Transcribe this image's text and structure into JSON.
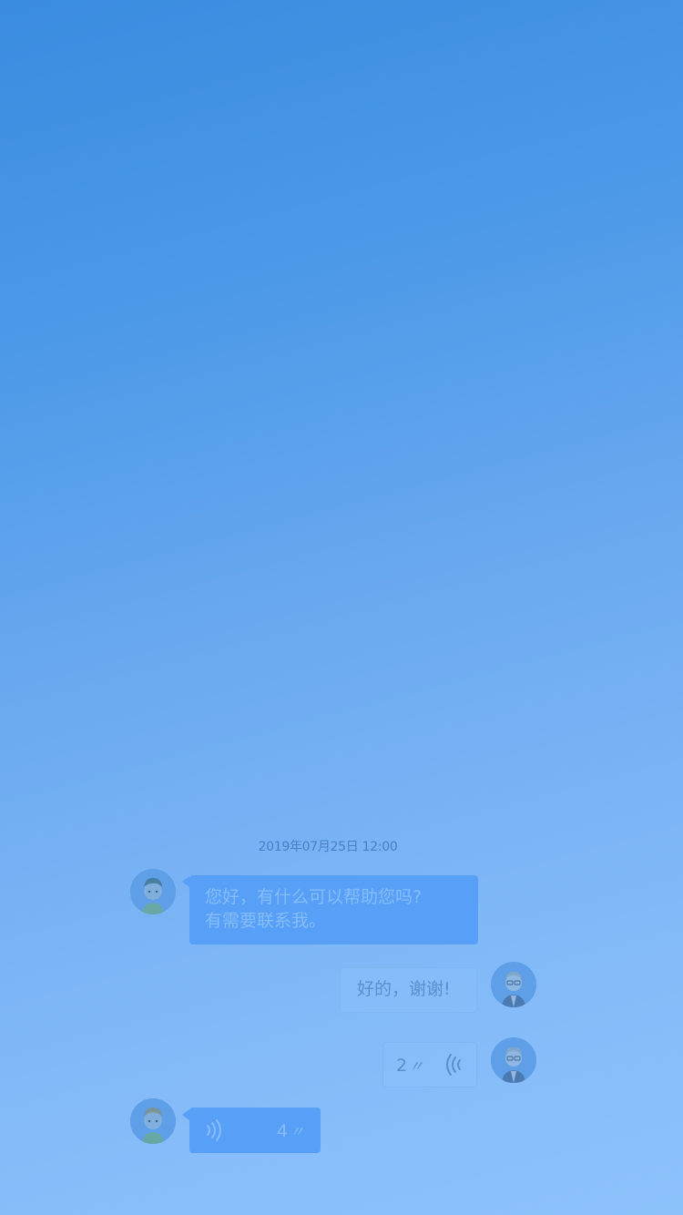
{
  "chat": {
    "timestamp": "2019年07月25日 12:00",
    "messages": [
      {
        "from": "agent",
        "type": "text",
        "text": "您好，有什么可以帮助您吗?\n有需要联系我。",
        "avatar": "agent-avatar"
      },
      {
        "from": "user",
        "type": "text",
        "text": "好的，谢谢!",
        "avatar": "user-avatar"
      },
      {
        "from": "user",
        "type": "voice",
        "duration": "2",
        "duration_mark": "〃",
        "icon": "voice-wave-icon"
      },
      {
        "from": "agent",
        "type": "voice",
        "duration": "4",
        "duration_mark": "〃",
        "icon": "voice-wave-icon"
      }
    ]
  },
  "colors": {
    "background_top": "#3a8ce0",
    "background_bottom": "#8fc2fb",
    "incoming_bubble": "#579ff7",
    "timestamp": "#4a7fc6"
  }
}
